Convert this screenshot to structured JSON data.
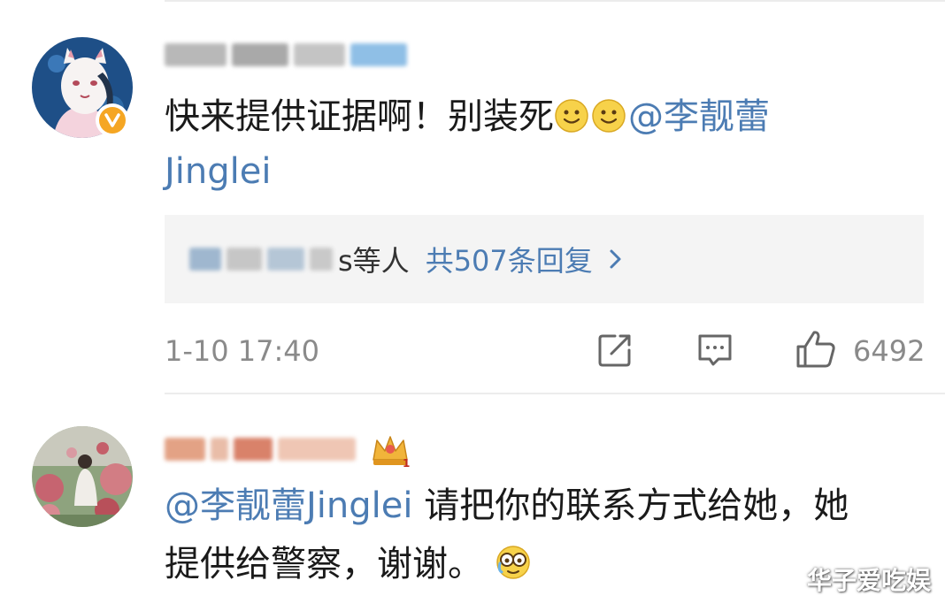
{
  "comments": [
    {
      "text_main": "快来提供证据啊！别装死",
      "emoji_names": [
        "smile-emoji",
        "smile-emoji"
      ],
      "mention_line1": "@李靓蕾",
      "mention_line2": "Jinglei",
      "reply": {
        "names_suffix": "s等人",
        "count_label": "共507条回复"
      },
      "timestamp": "1-10 17:40",
      "like_count": "6492",
      "verified_badge_color": "#f5a623"
    },
    {
      "mention": "@李靓蕾Jinglei",
      "text_line1": " 请把你的联系方式给她，她",
      "text_line2": "提供给警察，谢谢。",
      "emoji_name": "crying-laughing-emoji"
    }
  ],
  "colors": {
    "link": "#4c7cb3",
    "meta": "#8a8a8a",
    "reply_bg": "#f4f4f4"
  },
  "watermark": "华子爱吃娱"
}
